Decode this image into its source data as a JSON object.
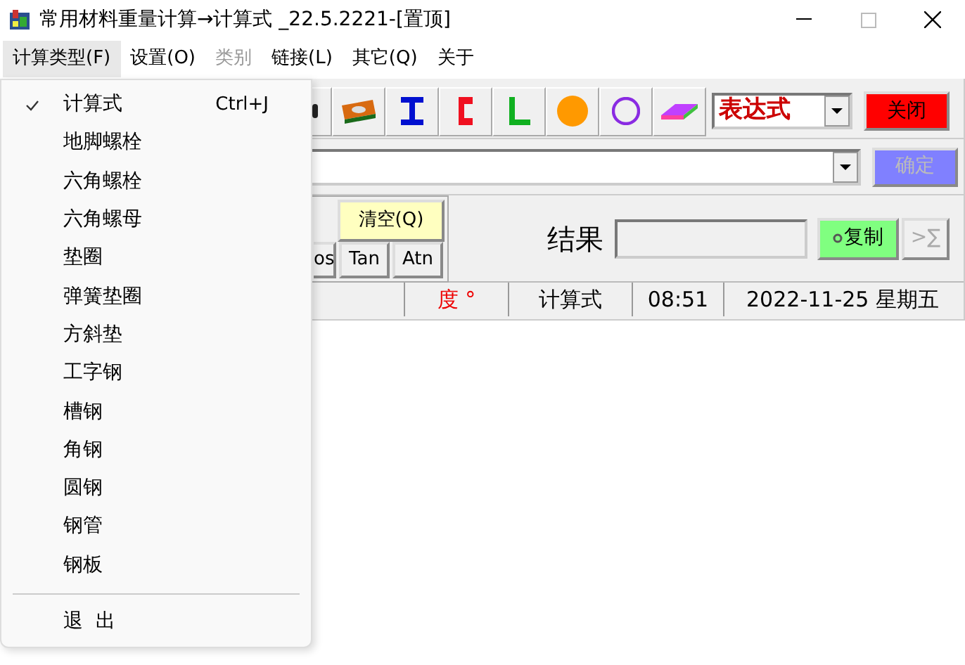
{
  "window": {
    "title": "常用材料重量计算→计算式 _22.5.2221-[置顶]"
  },
  "menu_bar": [
    {
      "label": "计算类型(F)",
      "selected": true,
      "disabled": false
    },
    {
      "label": "设置(O)",
      "selected": false,
      "disabled": false
    },
    {
      "label": "类别",
      "selected": false,
      "disabled": true
    },
    {
      "label": "链接(L)",
      "selected": false,
      "disabled": false
    },
    {
      "label": "其它(Q)",
      "selected": false,
      "disabled": false
    },
    {
      "label": "关于",
      "selected": false,
      "disabled": false
    }
  ],
  "dropdown_menu": [
    {
      "label": "计算式",
      "shortcut": "Ctrl+J",
      "checked": true
    },
    {
      "label": "地脚螺栓",
      "checked": false
    },
    {
      "label": "六角螺栓",
      "checked": false
    },
    {
      "label": "六角螺母",
      "checked": false
    },
    {
      "label": "垫圈",
      "checked": false
    },
    {
      "label": "弹簧垫圈",
      "checked": false
    },
    {
      "label": "方斜垫",
      "checked": false
    },
    {
      "label": "工字钢",
      "checked": false
    },
    {
      "label": "槽钢",
      "checked": false
    },
    {
      "label": "角钢",
      "checked": false
    },
    {
      "label": "圆钢",
      "checked": false
    },
    {
      "label": "钢管",
      "checked": false
    },
    {
      "label": "钢板",
      "checked": false
    },
    {
      "kind": "separator"
    },
    {
      "label": "退  出",
      "checked": false
    }
  ],
  "mode_select": {
    "value": "表达式"
  },
  "close_button": {
    "label": "关闭"
  },
  "confirm_button": {
    "label": "确定",
    "disabled": true
  },
  "keypad": {
    "clear": "清空(Q)",
    "functions": [
      "os",
      "Tan",
      "Atn"
    ]
  },
  "result": {
    "label": "结果",
    "copy_button": "复制",
    "sum_button": ">∑",
    "sum_disabled": true
  },
  "status_bar": [
    "度 °",
    "计算式",
    "08:51",
    "2022-11-25  星期五"
  ]
}
